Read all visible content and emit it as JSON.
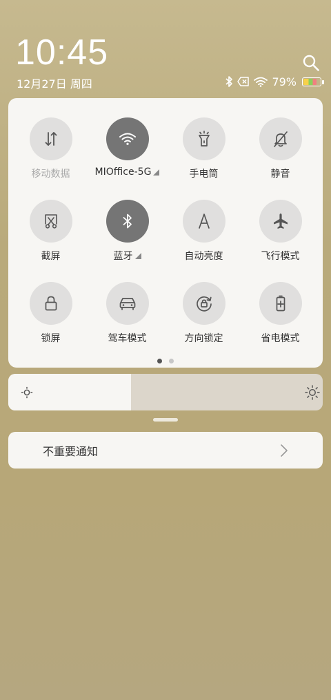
{
  "clock": {
    "time": "10:45",
    "date": "12月27日 周四"
  },
  "status": {
    "battery_percent_label": "79%",
    "battery_level": 0.79
  },
  "tiles": [
    {
      "label": "移动数据",
      "icon": "mobile-data-icon",
      "active": false,
      "disabled": true
    },
    {
      "label": "MIOffice-5G",
      "icon": "wifi-icon",
      "active": true
    },
    {
      "label": "手电筒",
      "icon": "flashlight-icon",
      "active": false
    },
    {
      "label": "静音",
      "icon": "mute-bell-icon",
      "active": false
    },
    {
      "label": "截屏",
      "icon": "screenshot-icon",
      "active": false
    },
    {
      "label": "蓝牙",
      "icon": "bluetooth-icon",
      "active": true
    },
    {
      "label": "自动亮度",
      "icon": "auto-brightness-icon",
      "active": false
    },
    {
      "label": "飞行模式",
      "icon": "airplane-icon",
      "active": false
    },
    {
      "label": "锁屏",
      "icon": "lock-icon",
      "active": false
    },
    {
      "label": "驾车模式",
      "icon": "car-icon",
      "active": false
    },
    {
      "label": "方向锁定",
      "icon": "rotation-lock-icon",
      "active": false
    },
    {
      "label": "省电模式",
      "icon": "battery-saver-icon",
      "active": false
    }
  ],
  "pager": {
    "pages": 2,
    "current": 1
  },
  "brightness": {
    "level": 0.39
  },
  "notification": {
    "label": "不重要通知"
  },
  "colors": {
    "tile_on": "#757575",
    "tile_off": "#e0dfde",
    "panel": "#f7f6f3"
  }
}
